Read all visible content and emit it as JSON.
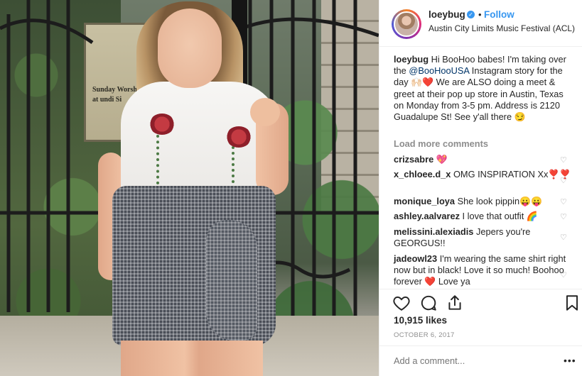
{
  "header": {
    "username": "loeybug",
    "verified_glyph": "✓",
    "separator": "•",
    "follow_label": "Follow",
    "location": "Austin City Limits Music Festival (ACL)"
  },
  "photo": {
    "sign_text": "Sunday Worsh at at undi Si"
  },
  "caption": {
    "username": "loeybug",
    "text_before_mention": "Hi BooHoo babes! I'm taking over the",
    "mention": "@BooHooUSA",
    "text_after_mention": "Instagram story for the day 🙌🏻❤️ We are ALSO doing a meet & greet at their pop up store in Austin, Texas on Monday from 3-5 pm. Address is 2120 Guadalupe St! See y'all there 😏"
  },
  "load_more_label": "Load more comments",
  "comments": [
    {
      "username": "crizsabre",
      "text": "💖"
    },
    {
      "username": "x_chloee.d_x",
      "text": "OMG INSPIRATION Xx❣️❣️"
    },
    {
      "username": "monique_loya",
      "text": "She look pippin😛😛"
    },
    {
      "username": "ashley.aalvarez",
      "text": "I love that outfit 🌈"
    },
    {
      "username": "melissini.alexiadis",
      "text": "Jepers you're GEORGUS!!"
    },
    {
      "username": "jadeowl23",
      "text": "I'm wearing the same shirt right now but in black! Love it so much! Boohoo forever ❤️ Love ya"
    }
  ],
  "comment_like_glyph": "♡",
  "icons": {
    "like": "heart-icon",
    "comment": "comment-icon",
    "share": "share-icon",
    "save": "bookmark-icon",
    "more": "more-icon"
  },
  "likes": "10,915 likes",
  "date": "OCTOBER 6, 2017",
  "add_comment": {
    "placeholder": "Add a comment...",
    "more_glyph": "•••"
  },
  "colors": {
    "link_blue": "#3897f0",
    "text": "#262626",
    "muted": "#8e8e8e",
    "mention": "#003569"
  }
}
